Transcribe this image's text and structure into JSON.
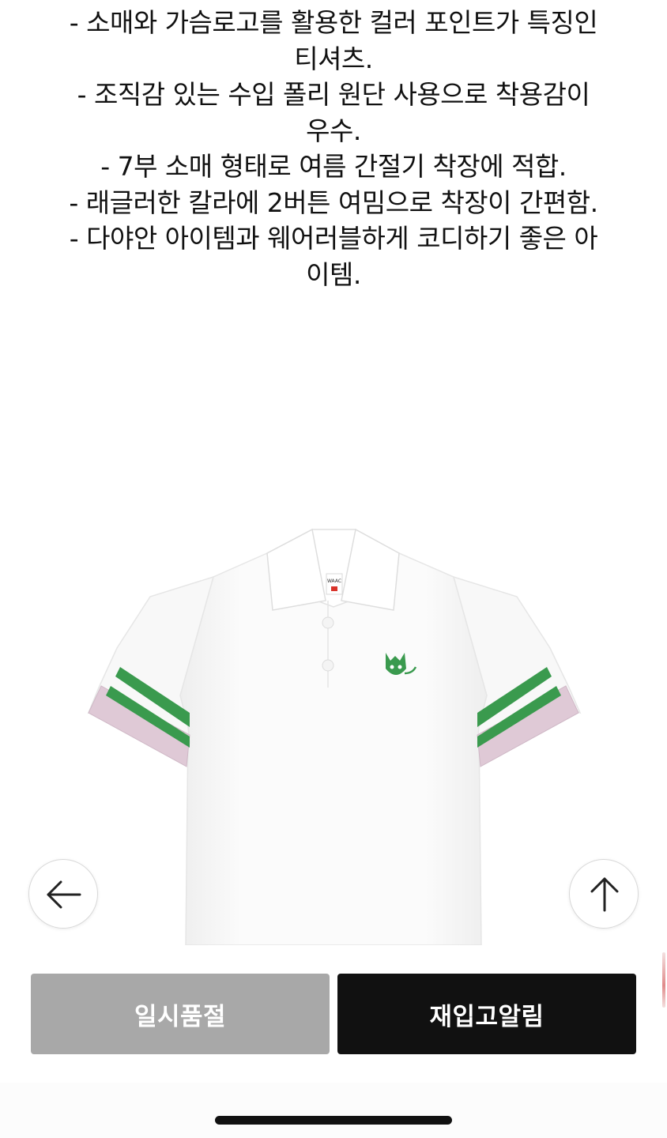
{
  "description": {
    "lines": [
      "- 소매와 가슴로고를 활용한 컬러 포인트가 특징인",
      "티셔츠.",
      "- 조직감 있는 수입 폴리 원단 사용으로 착용감이",
      "우수.",
      "- 7부 소매 형태로 여름 간절기 착장에 적합.",
      "- 래글러한 칼라에 2버튼 여밈으로 착장이 간편함.",
      "- 다야안 아이템과 웨어러블하게 코디하기 좋은 아",
      "이템."
    ]
  },
  "product": {
    "label_text": "WAAC",
    "image_icon": "polo-shirt-image",
    "colors": {
      "shirt": "#ffffff",
      "stripe": "#3a9a4e",
      "cuff": "#dfc9d6",
      "logo": "#3a9a4e"
    }
  },
  "nav": {
    "prev_icon": "arrow-left-icon",
    "top_icon": "arrow-up-icon"
  },
  "actions": {
    "soldout_label": "일시품절",
    "restock_label": "재입고알림",
    "soldout_color": "#a8a8a8",
    "restock_color": "#111111"
  }
}
